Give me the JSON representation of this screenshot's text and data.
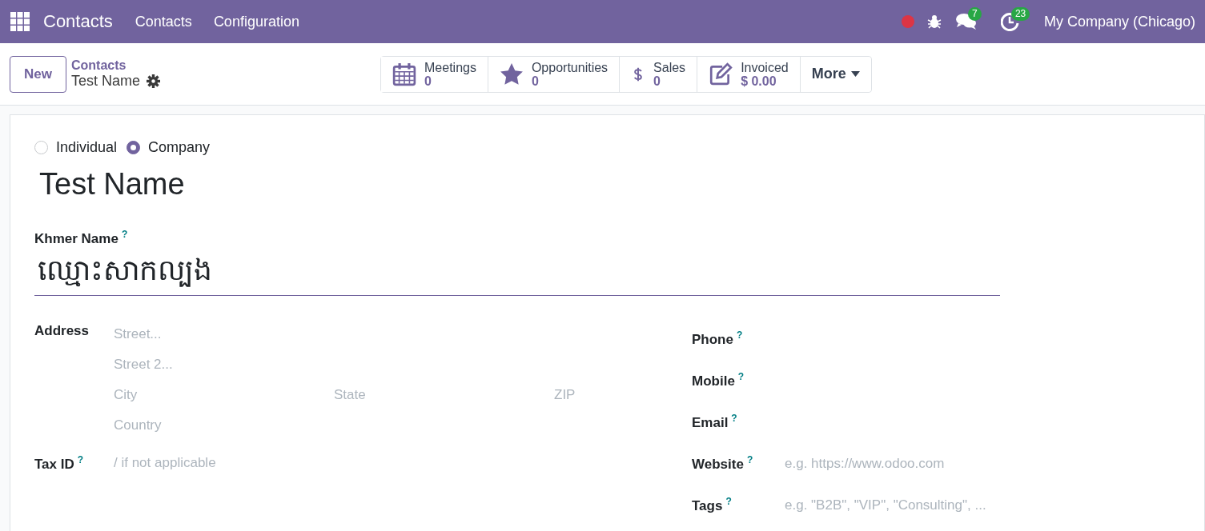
{
  "navbar": {
    "app_name": "Contacts",
    "menu": [
      "Contacts",
      "Configuration"
    ],
    "messages_count": "7",
    "activities_count": "23",
    "company": "My Company (Chicago)"
  },
  "control_panel": {
    "new_button": "New",
    "breadcrumb": "Contacts",
    "record_name": "Test Name"
  },
  "smart_buttons": [
    {
      "kind": "calendar",
      "label": "Meetings",
      "value": "0"
    },
    {
      "kind": "star",
      "label": "Opportunities",
      "value": "0"
    },
    {
      "kind": "dollar",
      "label": "Sales",
      "value": "0"
    },
    {
      "kind": "invoice",
      "label": "Invoiced",
      "value": "$ 0.00"
    }
  ],
  "more_button": "More",
  "company_type": [
    {
      "label": "Individual",
      "selected": false
    },
    {
      "label": "Company",
      "selected": true
    }
  ],
  "name": "Test Name",
  "khmer_name": {
    "label": "Khmer Name",
    "help": "?",
    "value": "ឈ្មោះសាកល្បង"
  },
  "address": {
    "label": "Address",
    "street": {
      "placeholder": "Street..."
    },
    "street2": {
      "placeholder": "Street 2..."
    },
    "city": {
      "placeholder": "City"
    },
    "state": {
      "placeholder": "State"
    },
    "zip": {
      "placeholder": "ZIP"
    },
    "country": {
      "placeholder": "Country"
    }
  },
  "tax_id": {
    "label": "Tax ID",
    "help": "?",
    "placeholder": "/ if not applicable"
  },
  "right_fields": [
    {
      "label": "Phone",
      "help": "?"
    },
    {
      "label": "Mobile",
      "help": "?"
    },
    {
      "label": "Email",
      "help": "?"
    },
    {
      "label": "Website",
      "help": "?",
      "placeholder": "e.g. https://www.odoo.com"
    },
    {
      "label": "Tags",
      "help": "?",
      "placeholder": "e.g. \"B2B\", \"VIP\", \"Consulting\", ..."
    }
  ]
}
